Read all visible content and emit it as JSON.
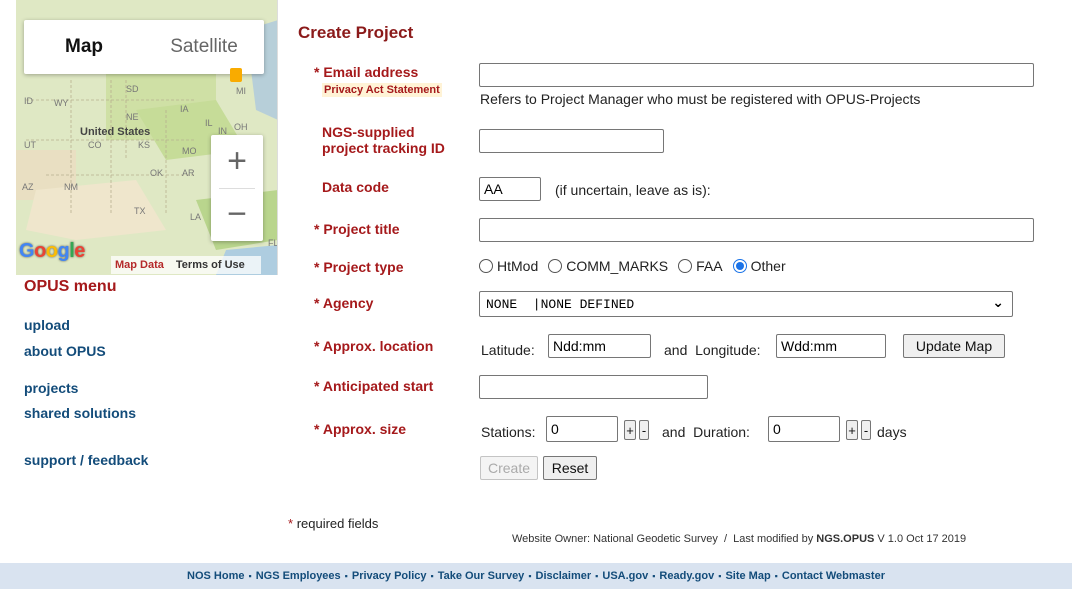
{
  "map": {
    "tab_map": "Map",
    "tab_satellite": "Satellite",
    "zoom_in": "+",
    "zoom_out": "−",
    "labels": {
      "sd": "SD",
      "wy": "WY",
      "ne": "NE",
      "ia": "IA",
      "il": "IL",
      "in": "IN",
      "oh": "OH",
      "us": "United States",
      "ut": "UT",
      "co": "CO",
      "ks": "KS",
      "mo": "MO",
      "ok": "OK",
      "ar": "AR",
      "az": "AZ",
      "nm": "NM",
      "tx": "TX",
      "la": "LA",
      "id": "ID",
      "mi": "MI",
      "fl": "FL"
    },
    "map_data": "Map Data",
    "terms": "Terms of Use"
  },
  "menu": {
    "title": "OPUS menu",
    "links": [
      "upload",
      "about OPUS",
      "projects",
      "shared solutions",
      "support / feedback"
    ]
  },
  "form": {
    "heading": "Create Project",
    "email": {
      "label": "Email address",
      "privacy": "Privacy Act Statement",
      "value": "",
      "help": "Refers to Project Manager who must be registered with OPUS-Projects"
    },
    "tracking": {
      "label_line1": "NGS-supplied",
      "label_line2": "project tracking ID",
      "value": ""
    },
    "data_code": {
      "label": "Data code",
      "value": "AA",
      "help": "(if uncertain, leave as is):"
    },
    "title": {
      "label": "Project title",
      "value": ""
    },
    "type": {
      "label": "Project type",
      "options": [
        "HtMod",
        "COMM_MARKS",
        "FAA",
        "Other"
      ],
      "selected": "Other"
    },
    "agency": {
      "label": "Agency",
      "value": "NONE  |NONE DEFINED"
    },
    "location": {
      "label": "Approx. location",
      "lat_label": "Latitude:",
      "lat_value": "Ndd:mm",
      "and_lon": "and  Longitude:",
      "lon_value": "Wdd:mm",
      "update_button": "Update Map"
    },
    "start": {
      "label": "Anticipated start",
      "value": ""
    },
    "size": {
      "label": "Approx. size",
      "stations_label": "Stations:",
      "stations_value": "0",
      "and_duration": "and  Duration:",
      "duration_value": "0",
      "plus": "+",
      "minus": "-",
      "days": "days"
    },
    "create_button": "Create",
    "reset_button": "Reset",
    "required_star": "*",
    "required_note": "required fields",
    "star": "*"
  },
  "owner": {
    "prefix": "Website Owner: National Geodetic Survey  /  Last modified by ",
    "bold": "NGS.OPUS",
    "suffix": " V 1.0 Oct 17 2019"
  },
  "footer": {
    "links": [
      "NOS Home",
      "NGS Employees",
      "Privacy Policy",
      "Take Our Survey",
      "Disclaimer",
      "USA.gov",
      "Ready.gov",
      "Site Map",
      "Contact Webmaster"
    ],
    "separator": "▪"
  }
}
